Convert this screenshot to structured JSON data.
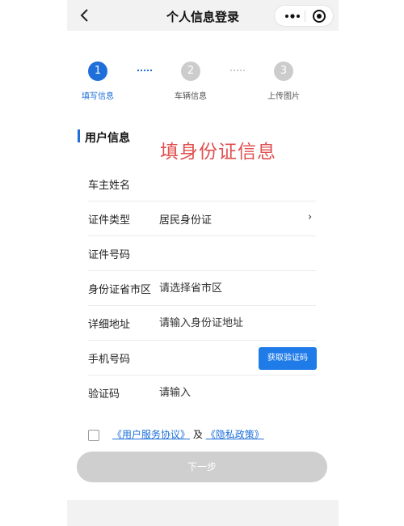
{
  "header": {
    "title": "个人信息登录",
    "back_icon": "chevron-left-icon",
    "more_icon": "more-dots-icon",
    "target_icon": "target-circle-icon"
  },
  "steps": [
    {
      "number": "1",
      "label": "填写信息",
      "active": true
    },
    {
      "number": "2",
      "label": "车辆信息",
      "active": false
    },
    {
      "number": "3",
      "label": "上传图片",
      "active": false
    }
  ],
  "section": {
    "title": "用户信息",
    "overlay_note": "填身份证信息"
  },
  "form": {
    "owner_name": {
      "label": "车主姓名",
      "placeholder": ""
    },
    "id_type": {
      "label": "证件类型",
      "value": "居民身份证",
      "chevron": "›"
    },
    "id_number": {
      "label": "证件号码",
      "placeholder": ""
    },
    "province": {
      "label": "身份证省市区",
      "placeholder": "请选择省市区"
    },
    "address": {
      "label": "详细地址",
      "placeholder": "请输入身份证地址"
    },
    "phone": {
      "label": "手机号码",
      "placeholder": "",
      "code_button": "获取验证码"
    },
    "code": {
      "label": "验证码",
      "placeholder": "请输入"
    }
  },
  "agreement": {
    "user_agreement": "《用户服务协议》",
    "connector": "及",
    "privacy_policy": "《隐私政策》"
  },
  "next_button": "下一步",
  "colors": {
    "accent": "#1e6fd9",
    "button_blue": "#1e7be8",
    "disabled": "#cfcfcf",
    "overlay": "#e05050",
    "inactive_step": "#cccccc"
  }
}
